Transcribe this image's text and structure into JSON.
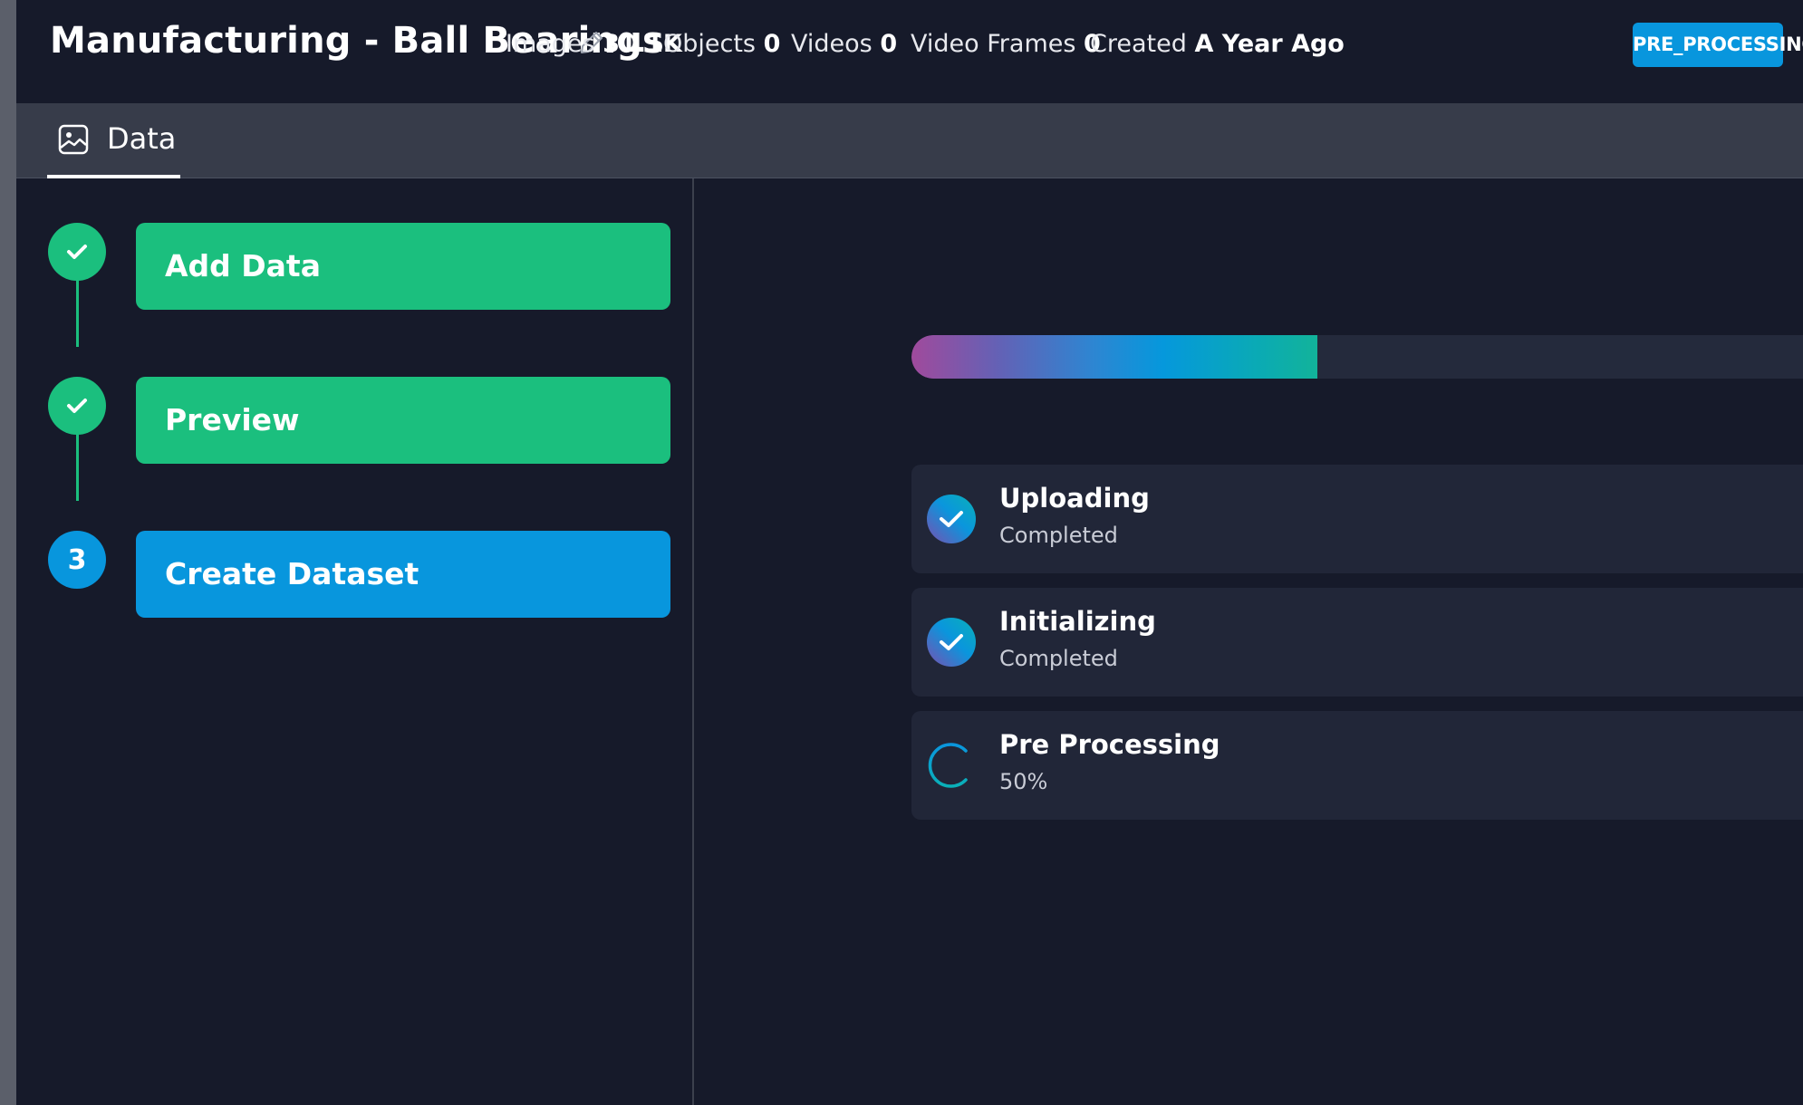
{
  "header": {
    "title": "Manufacturing - Ball Bearings",
    "stats": [
      {
        "label": "Images",
        "value": "31.1K"
      },
      {
        "label": "Objects",
        "value": "0"
      },
      {
        "label": "Videos",
        "value": "0"
      },
      {
        "label": "Video Frames",
        "value": "0"
      },
      {
        "label": "Created",
        "value": "A Year Ago"
      }
    ],
    "status": "PRE_PROCESSING"
  },
  "tabs": [
    {
      "label": "Data",
      "icon": "image-icon",
      "active": true
    }
  ],
  "steps": [
    {
      "label": "Add Data",
      "state": "completed",
      "icon": "check-icon"
    },
    {
      "label": "Preview",
      "state": "completed",
      "icon": "check-icon"
    },
    {
      "label": "Create Dataset",
      "state": "active",
      "number": "3"
    }
  ],
  "progress": {
    "fraction": 0.455
  },
  "tasks": [
    {
      "title": "Uploading",
      "status": "Completed",
      "icon": "check-circle-icon"
    },
    {
      "title": "Initializing",
      "status": "Completed",
      "icon": "check-circle-icon"
    },
    {
      "title": "Pre Processing",
      "status": "50%",
      "icon": "spinner-icon"
    }
  ],
  "colors": {
    "success": "#1bbf7e",
    "accent": "#0896dd",
    "background": "#161a2a"
  }
}
